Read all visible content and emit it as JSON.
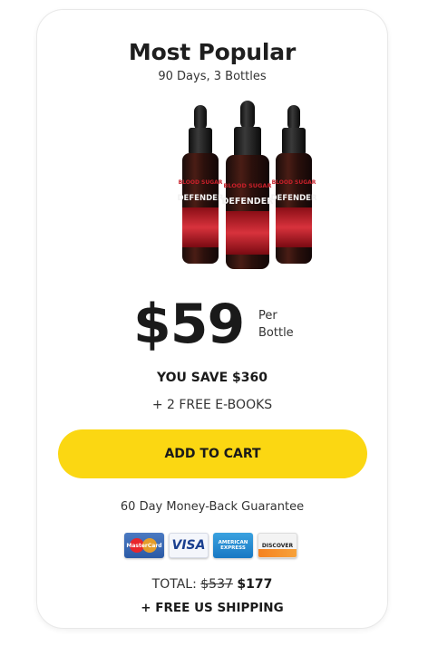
{
  "package": {
    "title": "Most Popular",
    "subtitle": "90 Days, 3 Bottles",
    "bottle_label": "DEFENDER",
    "bottle_label_top": "BLOOD SUGAR"
  },
  "price": {
    "amount": "$59",
    "per_line1": "Per",
    "per_line2": "Bottle"
  },
  "savings": {
    "text": "YOU SAVE $360",
    "bonus": "+ 2 FREE E-BOOKS"
  },
  "cta": {
    "label": "ADD TO CART",
    "color": "#fbd712"
  },
  "guarantee": "60 Day Money-Back Guarantee",
  "payment_methods": {
    "mastercard": "MasterCard",
    "visa": "VISA",
    "amex": "AMERICAN EXPRESS",
    "discover": "DISCOVER"
  },
  "total": {
    "label": "TOTAL:",
    "old_price": "$537",
    "new_price": "$177"
  },
  "shipping": "+ FREE US SHIPPING"
}
